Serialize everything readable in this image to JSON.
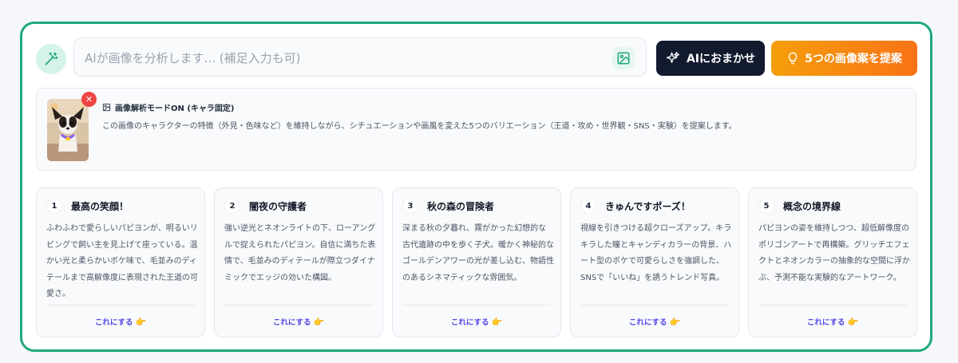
{
  "search": {
    "placeholder": "AIが画像を分析します... (補足入力も可)"
  },
  "buttons": {
    "ai_label": "AIにおまかせ",
    "suggest_label": "5つの画像案を提案"
  },
  "info": {
    "title": "画像解析モードON (キャラ固定)",
    "description": "この画像のキャラクターの特徴（外見・色味など）を維持しながら、シチュエーションや画風を変えた5つのバリエーション（王道・攻め・世界観・SNS・実験）を提案します。",
    "remove_label": "✕"
  },
  "cards": [
    {
      "num": "1",
      "title": "最高の笑顔！",
      "desc": "ふわふわで愛らしいパピヨンが、明るいリビングで飼い主を見上げて座っている。温かい光と柔らかいボケ味で、毛並みのディテールまで高解像度に表現された王道の可愛さ。",
      "cta": "これにする"
    },
    {
      "num": "2",
      "title": "闇夜の守護者",
      "desc": "強い逆光とネオンライトの下、ローアングルで捉えられたパピヨン。自信に満ちた表情で、毛並みのディテールが際立つダイナミックでエッジの効いた構図。",
      "cta": "これにする"
    },
    {
      "num": "3",
      "title": "秋の森の冒険者",
      "desc": "深まる秋の夕暮れ、霧がかった幻想的な古代遺跡の中を歩く子犬。暖かく神秘的なゴールデンアワーの光が差し込む、物語性のあるシネマティックな雰囲気。",
      "cta": "これにする"
    },
    {
      "num": "4",
      "title": "きゅんですポーズ！",
      "desc": "視線を引きつける超クローズアップ。キラキラした瞳とキャンディカラーの背景、ハート型のボケで可愛らしさを強調した、SNSで「いいね」を誘うトレンド写真。",
      "cta": "これにする"
    },
    {
      "num": "5",
      "title": "概念の境界線",
      "desc": "パピヨンの姿を維持しつつ、超低解像度のポリゴンアートで再構築。グリッチエフェクトとネオンカラーの抽象的な空間に浮かぶ、予測不能な実験的なアートワーク。",
      "cta": "これにする"
    }
  ],
  "icons": {
    "wand": "magic-wand-icon",
    "image": "image-icon",
    "sparkles": "sparkles-icon",
    "bulb": "lightbulb-icon",
    "hand": "pointing-hand-icon"
  },
  "colors": {
    "accent_green": "#1fa87e",
    "dark_button": "#121a2e",
    "orange_start": "#f59e0b",
    "orange_end": "#f97316",
    "link": "#4f46e5",
    "danger": "#ef4444"
  }
}
